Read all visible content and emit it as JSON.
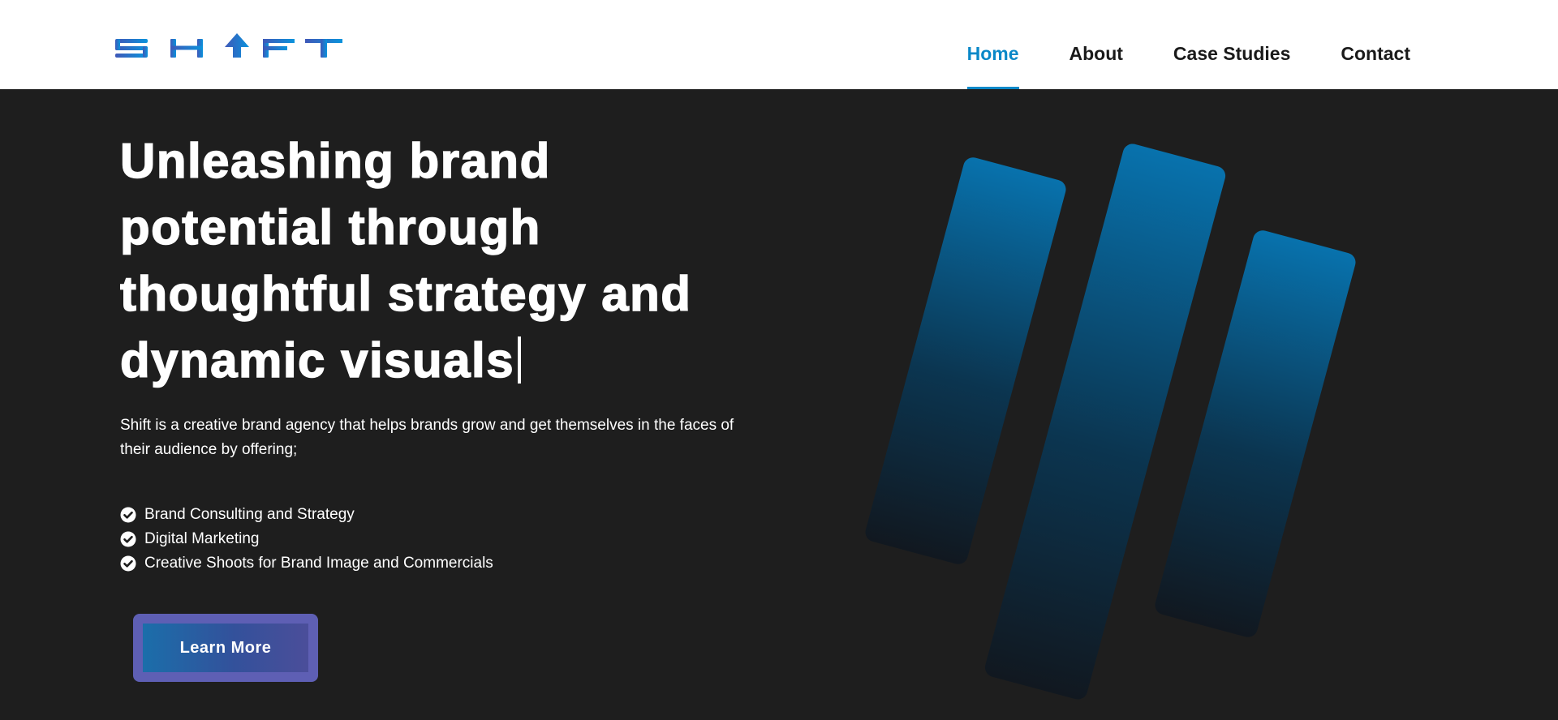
{
  "brand": {
    "logo_text": "SH↑FT",
    "logo_gradient": [
      "#3f58b8",
      "#0a93dc"
    ]
  },
  "nav": {
    "items": [
      {
        "label": "Home",
        "active": true
      },
      {
        "label": "About",
        "active": false
      },
      {
        "label": "Case Studies",
        "active": false
      },
      {
        "label": "Contact",
        "active": false
      }
    ],
    "active_color": "#0a88c8"
  },
  "hero": {
    "title": "Unleashing brand potential through thoughtful strategy and dynamic visuals",
    "description": "Shift is a creative brand agency that helps brands grow and get themselves in the faces of their audience by offering;",
    "services": [
      "Brand Consulting and Strategy",
      "Digital Marketing",
      "Creative Shoots for Brand Image and Commercials"
    ],
    "cta_label": "Learn More"
  },
  "colors": {
    "background": "#1e1e1e",
    "header": "#ffffff",
    "accent": "#0a88c8",
    "cta_border": "#5e5fb4"
  },
  "icons": {
    "service_bullet": "check-circle-icon",
    "decor": "shift-stripes-graphic"
  }
}
